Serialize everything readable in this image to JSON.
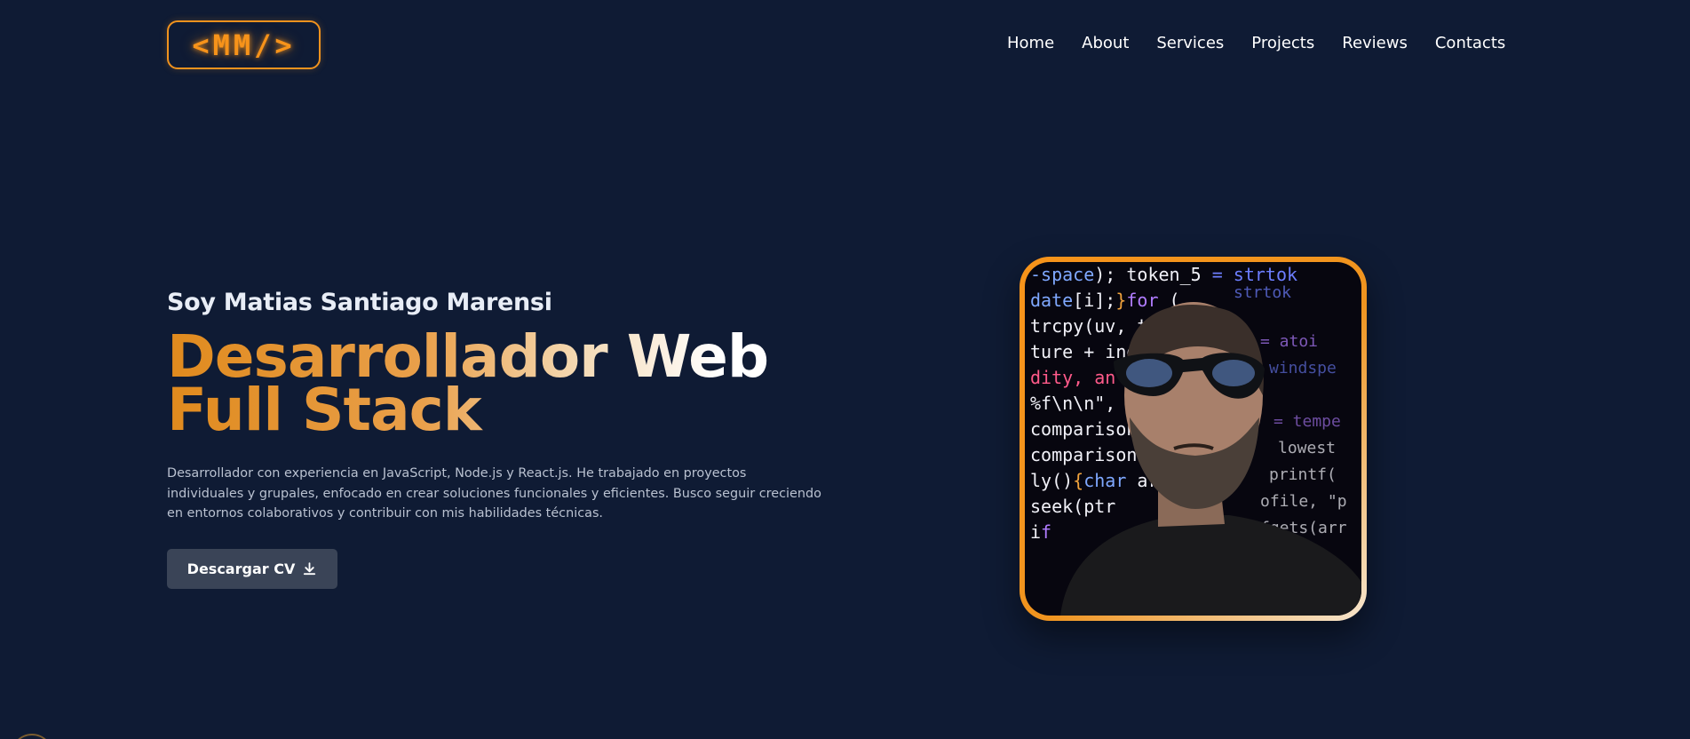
{
  "header": {
    "logo_text": "<MM/>",
    "nav": [
      "Home",
      "About",
      "Services",
      "Projects",
      "Reviews",
      "Contacts"
    ]
  },
  "hero": {
    "greeting": "Soy Matias Santiago Marensi",
    "title": "Desarrollador Web Full Stack",
    "bio": "Desarrollador con experiencia en JavaScript, Node.js y React.js. He trabajado en proyectos individuales y grupales, enfocado en crear soluciones funcionales y eficientes. Busco seguir creciendo en entornos colaborativos y contribuir con mis habilidades técnicas.",
    "cv_button": "Descargar CV"
  },
  "colors": {
    "background": "#0f1b34",
    "accent": "#f7931a",
    "button_bg": "#3a4457"
  },
  "icons": {
    "download": "download-icon"
  }
}
